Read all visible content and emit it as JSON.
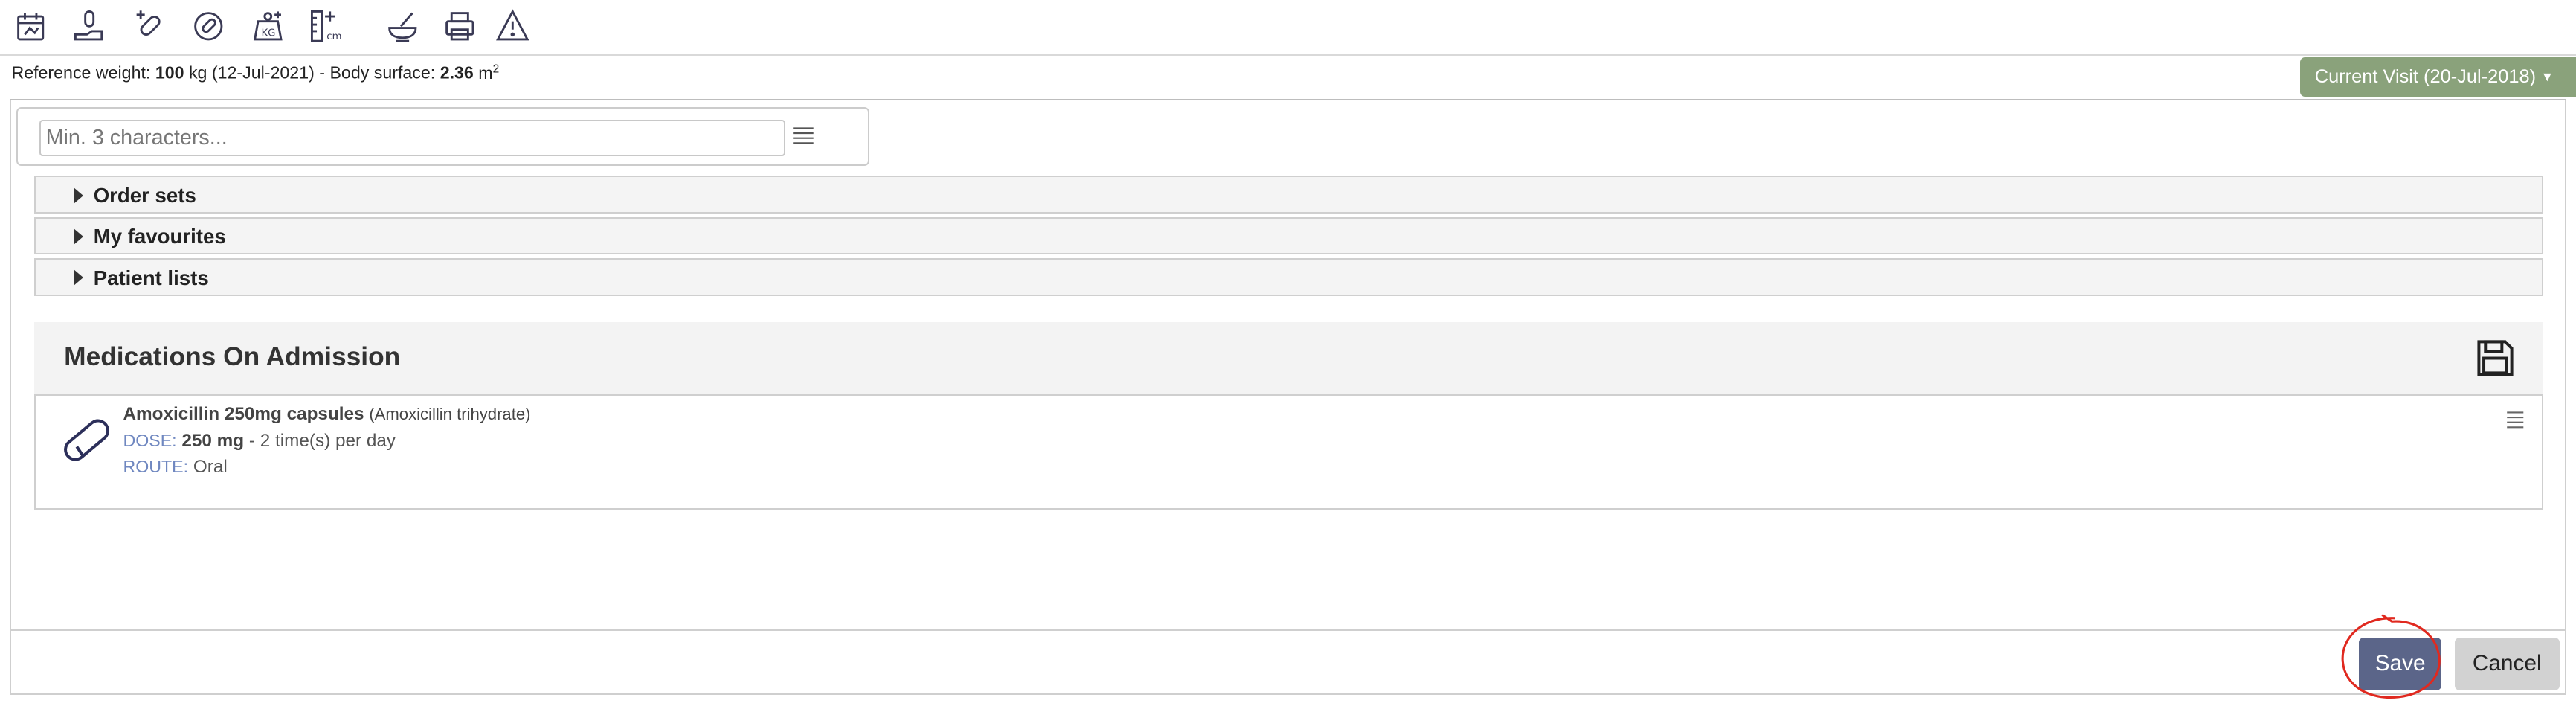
{
  "toolbar": {
    "icons": [
      "calendar-icon",
      "hand-pill-icon",
      "pill-plus-icon",
      "pill-circle-icon",
      "weigh-scale-icon",
      "height-ruler-icon",
      "mortar-pestle-icon",
      "printer-icon",
      "warning-icon"
    ]
  },
  "reference": {
    "weight_label": "Reference weight:",
    "weight_value": "100",
    "weight_unit": "kg",
    "weight_date": "(12-Jul-2021)",
    "separator": "-",
    "surface_label": "Body surface:",
    "surface_value": "2.36",
    "surface_unit": "m",
    "surface_exp": "2"
  },
  "visit": {
    "label": "Current Visit (20-Jul-2018)"
  },
  "search": {
    "placeholder": "Min. 3 characters..."
  },
  "accordions": [
    {
      "label": "Order sets"
    },
    {
      "label": "My favourites"
    },
    {
      "label": "Patient lists"
    }
  ],
  "medications": {
    "title": "Medications On Admission",
    "items": [
      {
        "name": "Amoxicillin 250mg capsules",
        "generic": "(Amoxicillin trihydrate)",
        "dose_label": "DOSE:",
        "dose_value": "250 mg",
        "dose_freq": "- 2 time(s) per day",
        "route_label": "ROUTE:",
        "route_value": "Oral"
      }
    ]
  },
  "buttons": {
    "save": "Save",
    "cancel": "Cancel"
  },
  "colors": {
    "visit_button": "#8aa27b",
    "save_button": "#5b6589",
    "cancel_button": "#d2d2d2",
    "label_blue": "#6f87c0",
    "annotation_red": "#e0291f"
  }
}
